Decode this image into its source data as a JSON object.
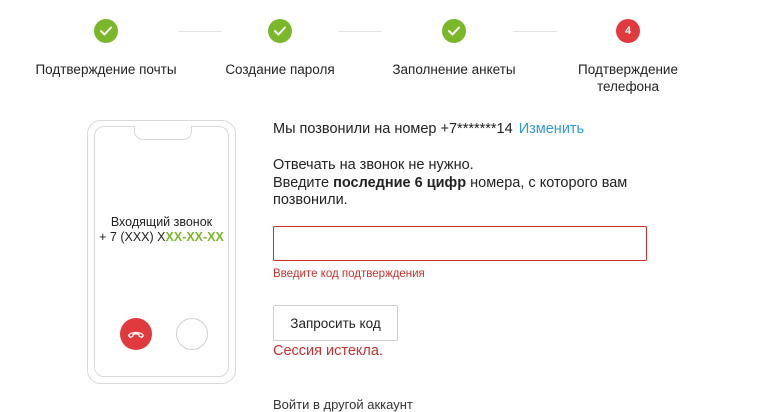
{
  "stepper": {
    "steps": [
      {
        "label": "Подтверждение почты",
        "state": "done"
      },
      {
        "label": "Создание пароля",
        "state": "done"
      },
      {
        "label": "Заполнение анкеты",
        "state": "done"
      },
      {
        "label": "Подтверждение телефона",
        "state": "current",
        "number": "4"
      }
    ],
    "colors": {
      "done": "#7ab82a",
      "current": "#e0393e"
    }
  },
  "phone_illustration": {
    "incoming_title": "Входящий звонок",
    "number_prefix": "+ 7 (XXX) X",
    "number_highlight": "XX-XX-XX",
    "icons": [
      "decline-call-icon",
      "answer-call-icon"
    ]
  },
  "form": {
    "called_text": "Мы позвонили на номер +7*******14",
    "change_link": "Изменить",
    "instruction_line1": "Отвечать на звонок не нужно.",
    "instruction_prefix": "Введите ",
    "instruction_bold": "последние 6 цифр",
    "instruction_suffix": " номера, с которого вам позвонили.",
    "code_value": "",
    "code_error": "Введите код подтверждения",
    "request_button": "Запросить код",
    "session_error": "Сессия истекла.",
    "other_account_link": "Войти в другой аккаунт"
  },
  "colors": {
    "accent_green": "#7ab82a",
    "error_red": "#c9302c",
    "link_blue": "#2f9bd4"
  }
}
